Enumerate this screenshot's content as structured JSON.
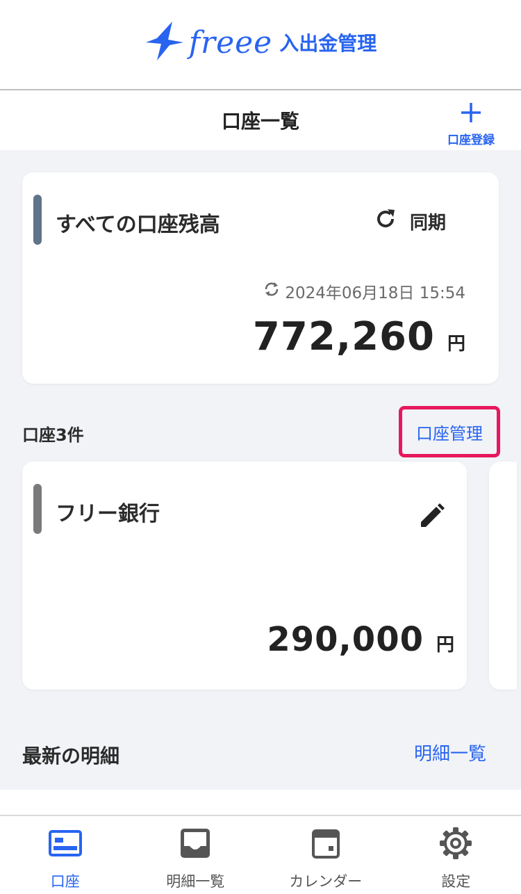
{
  "header": {
    "logo_wordmark": "freee",
    "logo_product": "入出金管理"
  },
  "subheader": {
    "title": "口座一覧",
    "add_account_label": "口座登録"
  },
  "total_card": {
    "title": "すべての口座残高",
    "sync_label": "同期",
    "sync_timestamp": "2024年06月18日 15:54",
    "amount": "772,260",
    "unit": "円"
  },
  "accounts_section": {
    "count_label": "口座3件",
    "manage_link": "口座管理"
  },
  "bank_card": {
    "name": "フリー銀行",
    "amount": "290,000",
    "unit": "円"
  },
  "latest_section": {
    "title": "最新の明細",
    "link": "明細一覧"
  },
  "tabs": [
    {
      "label": "口座",
      "icon": "card-icon",
      "active": true
    },
    {
      "label": "明細一覧",
      "icon": "inbox-icon",
      "active": false
    },
    {
      "label": "カレンダー",
      "icon": "calendar-icon",
      "active": false
    },
    {
      "label": "設定",
      "icon": "gear-icon",
      "active": false
    }
  ],
  "colors": {
    "accent": "#2864f0",
    "highlight_border": "#e8175d",
    "background": "#f1f3f7"
  }
}
